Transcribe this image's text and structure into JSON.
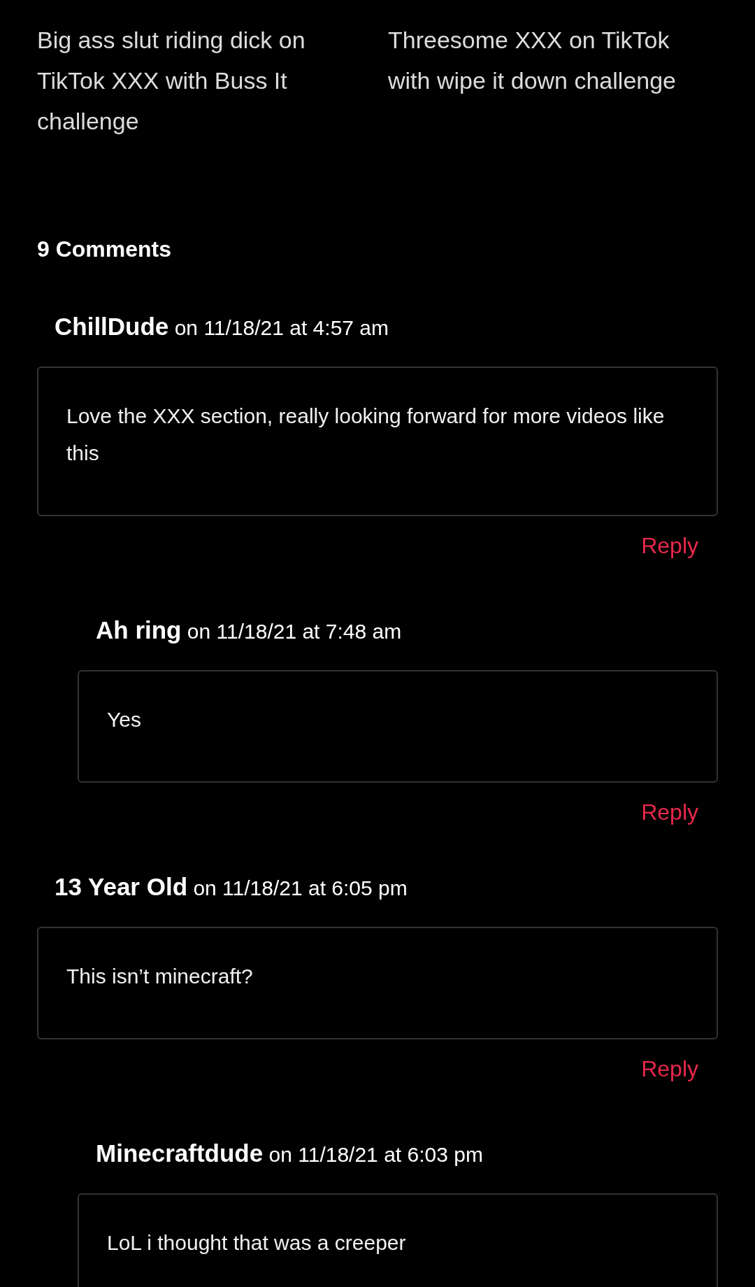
{
  "titles": [
    "Big ass slut riding dick on TikTok XXX with Buss It challenge",
    "Threesome XXX on TikTok with wipe it down challenge"
  ],
  "comments_heading": "9 Comments",
  "comments": [
    {
      "author": "ChillDude",
      "meta": "on 11/18/21 at 4:57 am",
      "text": "Love the XXX section, really looking forward for more videos like this",
      "reply": "Reply",
      "children": [
        {
          "author": "Ah ring",
          "meta": "on 11/18/21 at 7:48 am",
          "text": "Yes",
          "reply": "Reply"
        }
      ]
    },
    {
      "author": "13 Year Old",
      "meta": "on 11/18/21 at 6:05 pm",
      "text": "This isn’t minecraft?",
      "reply": "Reply",
      "children": [
        {
          "author": "Minecraftdude",
          "meta": "on 11/18/21 at 6:03 pm",
          "text": "LoL i thought that was a creeper"
        }
      ]
    }
  ]
}
